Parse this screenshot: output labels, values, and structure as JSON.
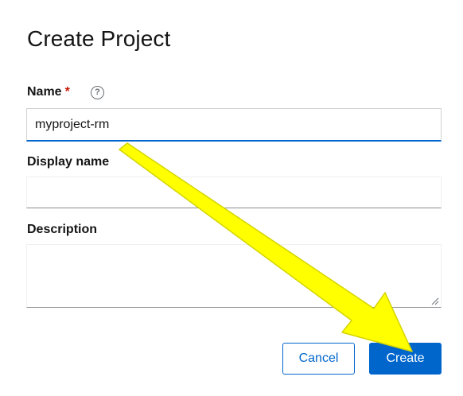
{
  "dialog": {
    "title": "Create Project"
  },
  "form": {
    "name": {
      "label": "Name",
      "required_marker": "*",
      "help_icon": "question-circle-icon",
      "help_glyph": "?",
      "value": "myproject-rm"
    },
    "display_name": {
      "label": "Display name",
      "value": ""
    },
    "description": {
      "label": "Description",
      "value": ""
    }
  },
  "actions": {
    "cancel_label": "Cancel",
    "create_label": "Create"
  },
  "annotation": {
    "icon": "arrow-pointer",
    "color": "#ffff00"
  },
  "colors": {
    "primary": "#0066cc",
    "required": "#c9190b"
  }
}
